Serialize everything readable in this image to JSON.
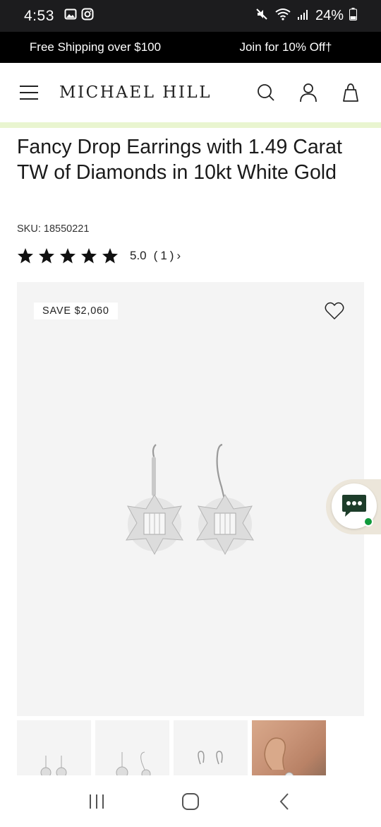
{
  "status_bar": {
    "time": "4:53",
    "battery": "24%",
    "icons": [
      "image-icon",
      "instagram-icon",
      "mute-icon",
      "wifi-icon",
      "signal-icon",
      "battery-icon"
    ]
  },
  "promo": {
    "left": "Free Shipping over $100",
    "right": "Join for 10% Off†"
  },
  "header": {
    "logo": "MICHAEL HILL",
    "icons": [
      "menu-icon",
      "search-icon",
      "account-icon",
      "bag-icon"
    ]
  },
  "product": {
    "title": "Fancy Drop Earrings with 1.49 Carat TW of Diamonds in 10kt White Gold",
    "sku_label": "SKU:",
    "sku_value": "18550221",
    "rating": {
      "stars": 5,
      "score": "5.0",
      "count_open": "(",
      "count": "1",
      "count_close": ")",
      "chevron": "›"
    }
  },
  "gallery": {
    "badge": "SAVE $2,060",
    "thumbnails": [
      "front view",
      "side view",
      "back view",
      "worn on ear"
    ]
  },
  "colors": {
    "promo_bg": "#000000",
    "accent_strip": "#e9f5d0",
    "gallery_bg": "#f4f4f4",
    "chat_status": "#109a3c"
  }
}
